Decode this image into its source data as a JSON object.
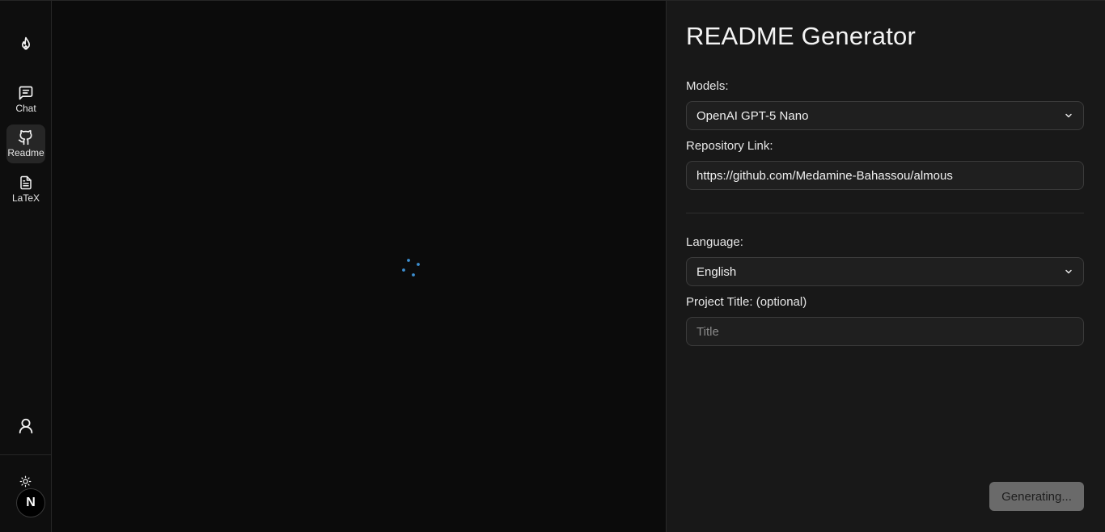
{
  "sidebar": {
    "logo_icon": "flame-icon",
    "items": [
      {
        "label": "Chat",
        "icon": "message-square-icon",
        "active": false
      },
      {
        "label": "Readme",
        "icon": "github-icon",
        "active": true
      },
      {
        "label": "LaTeX",
        "icon": "file-text-icon",
        "active": false
      }
    ],
    "user_icon": "user-icon",
    "theme_icon": "sun-icon",
    "badge_letter": "N"
  },
  "preview": {
    "state": "loading",
    "spinner_color": "#3d8fd1"
  },
  "panel": {
    "title": "README Generator",
    "models_label": "Models:",
    "models_value": "OpenAI GPT-5 Nano",
    "repo_label": "Repository Link:",
    "repo_value": "https://github.com/Medamine-Bahassou/almous",
    "language_label": "Language:",
    "language_value": "English",
    "project_title_label": "Project Title: (optional)",
    "project_title_placeholder": "Title",
    "generate_label": "Generating..."
  }
}
